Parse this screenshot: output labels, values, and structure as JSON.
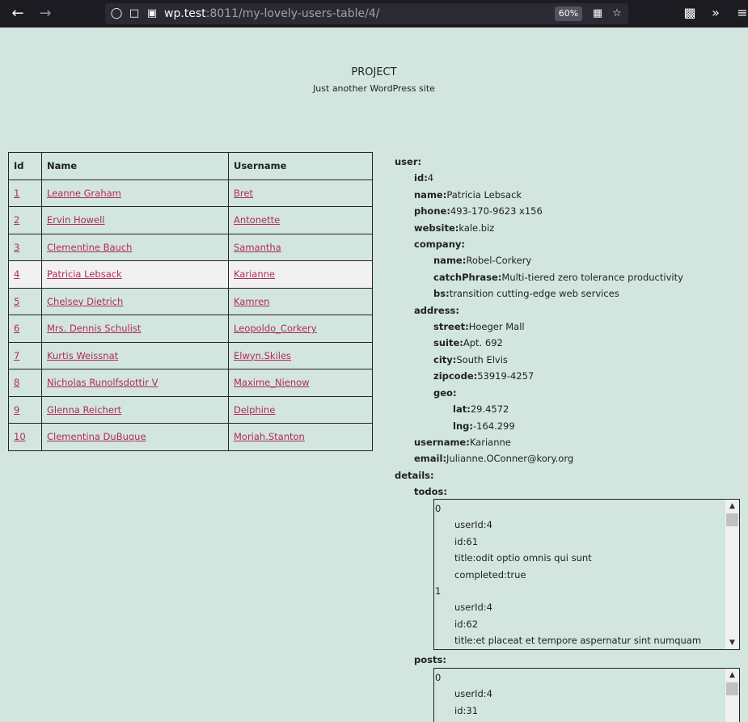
{
  "browser": {
    "url_host": "wp.test",
    "url_rest": ":8011/my-lovely-users-table/4/",
    "zoom": "60%"
  },
  "site": {
    "title": "PROJECT",
    "description": "Just another WordPress site"
  },
  "table": {
    "headers": [
      "Id",
      "Name",
      "Username"
    ],
    "rows": [
      {
        "id": "1",
        "name": "Leanne Graham",
        "username": "Bret"
      },
      {
        "id": "2",
        "name": "Ervin Howell",
        "username": "Antonette"
      },
      {
        "id": "3",
        "name": "Clementine Bauch",
        "username": "Samantha"
      },
      {
        "id": "4",
        "name": "Patricia Lebsack",
        "username": "Karianne"
      },
      {
        "id": "5",
        "name": "Chelsey Dietrich",
        "username": "Kamren"
      },
      {
        "id": "6",
        "name": "Mrs. Dennis Schulist",
        "username": "Leopoldo_Corkery"
      },
      {
        "id": "7",
        "name": "Kurtis Weissnat",
        "username": "Elwyn.Skiles"
      },
      {
        "id": "8",
        "name": "Nicholas Runolfsdottir V",
        "username": "Maxime_Nienow"
      },
      {
        "id": "9",
        "name": "Glenna Reichert",
        "username": "Delphine"
      },
      {
        "id": "10",
        "name": "Clementina DuBuque",
        "username": "Moriah.Stanton"
      }
    ]
  },
  "detail": {
    "user_key": "user",
    "id_key": "id",
    "id": "4",
    "name_key": "name",
    "name": "Patricia Lebsack",
    "phone_key": "phone",
    "phone": "493-170-9623 x156",
    "website_key": "website",
    "website": "kale.biz",
    "company_key": "company",
    "company_name_key": "name",
    "company_name": "Robel-Corkery",
    "catch_key": "catchPhrase",
    "catch": "Multi-tiered zero tolerance productivity",
    "bs_key": "bs",
    "bs": "transition cutting-edge web services",
    "address_key": "address",
    "street_key": "street",
    "street": "Hoeger Mall",
    "suite_key": "suite",
    "suite": "Apt. 692",
    "city_key": "city",
    "city": "South Elvis",
    "zip_key": "zipcode",
    "zip": "53919-4257",
    "geo_key": "geo",
    "lat_key": "lat",
    "lat": "29.4572",
    "lng_key": "lng",
    "lng": "-164.299",
    "username_key": "username",
    "username": "Karianne",
    "email_key": "email",
    "email": "Julianne.OConner@kory.org",
    "details_key": "details",
    "todos_key": "todos",
    "todos": [
      {
        "index": "0",
        "userId": "4",
        "id": "61",
        "title": "odit optio omnis qui sunt",
        "completed": "true"
      },
      {
        "index": "1",
        "userId": "4",
        "id": "62",
        "title": "et placeat et tempore aspernatur sint numquam"
      }
    ],
    "posts_key": "posts",
    "posts": [
      {
        "index": "0",
        "userId": "4",
        "id": "31"
      }
    ],
    "field_labels": {
      "userId": "userId",
      "id": "id",
      "title": "title",
      "completed": "completed"
    }
  }
}
